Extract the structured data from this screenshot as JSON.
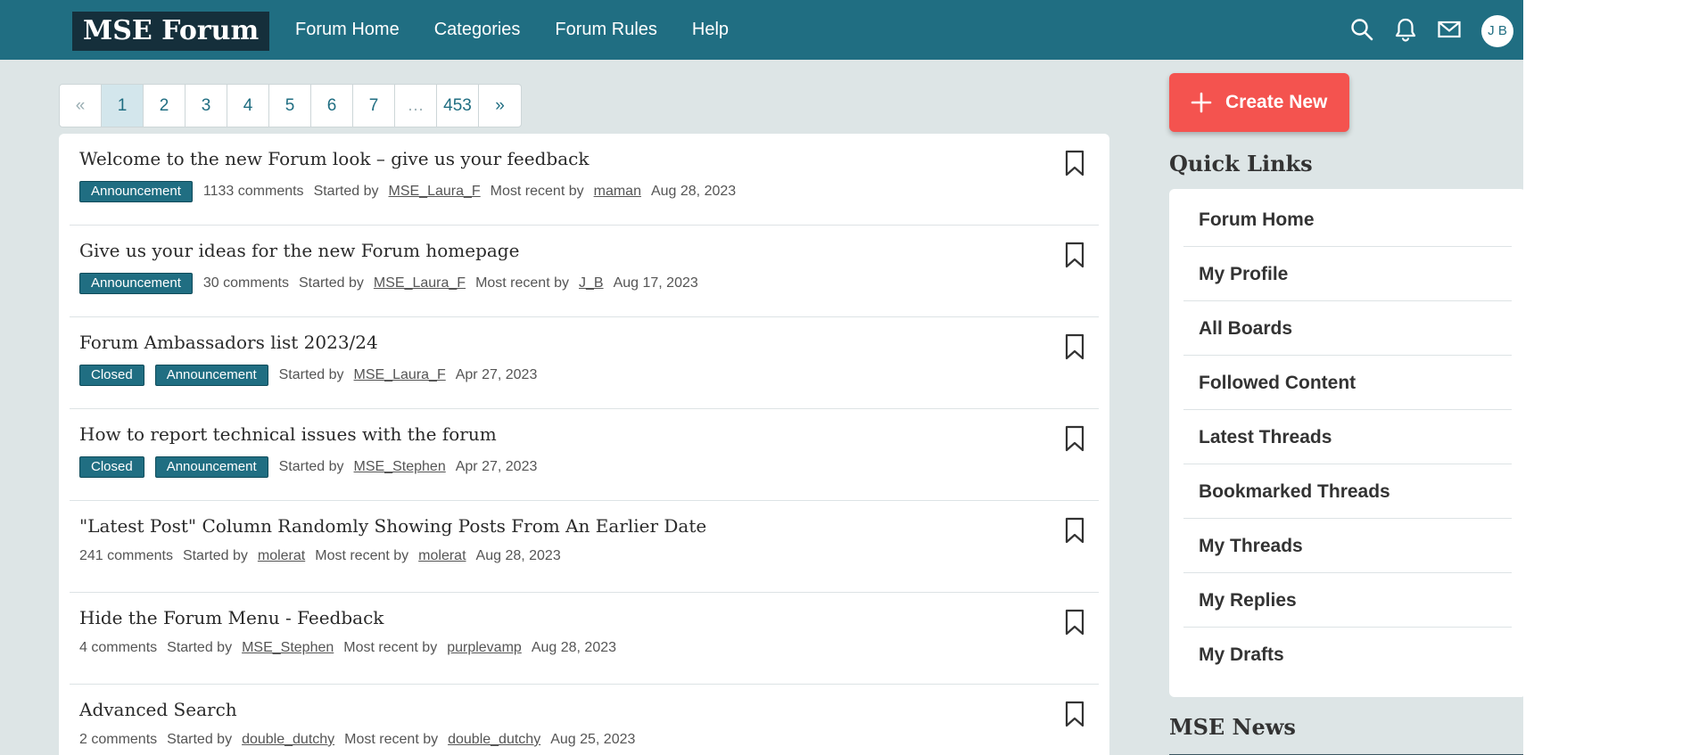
{
  "header": {
    "logo": "MSE Forum",
    "nav": [
      "Forum Home",
      "Categories",
      "Forum Rules",
      "Help"
    ],
    "icons": [
      "search-icon",
      "bell-icon",
      "mail-icon"
    ],
    "avatar_initials": "J B",
    "colors": {
      "bar": "#206e82",
      "logo_bg": "#152f3b"
    }
  },
  "pagination": {
    "prev": "«",
    "pages": [
      "1",
      "2",
      "3",
      "4",
      "5",
      "6",
      "7",
      "…",
      "453"
    ],
    "next": "»",
    "current": "1"
  },
  "threads": [
    {
      "title": "Welcome to the new Forum look – give us your feedback",
      "tags": [
        "Announcement"
      ],
      "comments": "1133 comments",
      "started_label": "Started by",
      "started_by": "MSE_Laura_F",
      "recent_label": "Most recent by",
      "recent_by": "maman",
      "date": "Aug 28, 2023"
    },
    {
      "title": "Give us your ideas for the new Forum homepage",
      "tags": [
        "Announcement"
      ],
      "comments": "30 comments",
      "started_label": "Started by",
      "started_by": "MSE_Laura_F",
      "recent_label": "Most recent by",
      "recent_by": "J_B",
      "date": "Aug 17, 2023"
    },
    {
      "title": "Forum Ambassadors list 2023/24",
      "tags": [
        "Closed",
        "Announcement"
      ],
      "comments": "",
      "started_label": "Started by",
      "started_by": "MSE_Laura_F",
      "recent_label": "",
      "recent_by": "",
      "date": "Apr 27, 2023"
    },
    {
      "title": "How to report technical issues with the forum",
      "tags": [
        "Closed",
        "Announcement"
      ],
      "comments": "",
      "started_label": "Started by",
      "started_by": "MSE_Stephen",
      "recent_label": "",
      "recent_by": "",
      "date": "Apr 27, 2023"
    },
    {
      "title": "\"Latest Post\" Column Randomly Showing Posts From An Earlier Date",
      "tags": [],
      "comments": "241 comments",
      "started_label": "Started by",
      "started_by": "molerat",
      "recent_label": "Most recent by",
      "recent_by": "molerat",
      "date": "Aug 28, 2023"
    },
    {
      "title": "Hide the Forum Menu - Feedback",
      "tags": [],
      "comments": "4 comments",
      "started_label": "Started by",
      "started_by": "MSE_Stephen",
      "recent_label": "Most recent by",
      "recent_by": "purplevamp",
      "date": "Aug 28, 2023"
    },
    {
      "title": "Advanced Search",
      "tags": [],
      "comments": "2 comments",
      "started_label": "Started by",
      "started_by": "double_dutchy",
      "recent_label": "Most recent by",
      "recent_by": "double_dutchy",
      "date": "Aug 25, 2023"
    }
  ],
  "sidebar": {
    "create_label": "Create New",
    "quick_links_title": "Quick Links",
    "quick_links": [
      "Forum Home",
      "My Profile",
      "All Boards",
      "Followed Content",
      "Latest Threads",
      "Bookmarked Threads",
      "My Threads",
      "My Replies",
      "My Drafts"
    ],
    "news_title": "MSE News",
    "colors": {
      "create_button": "#f4534f"
    }
  }
}
